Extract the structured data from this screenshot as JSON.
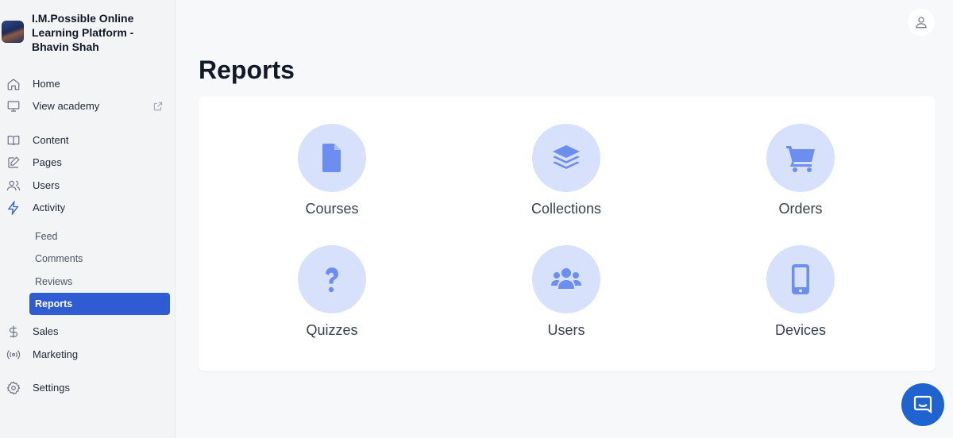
{
  "sidebar": {
    "brand": "I.M.Possible Online Learning Platform - Bhavin Shah",
    "items": [
      {
        "label": "Home",
        "icon": "home-icon"
      },
      {
        "label": "View academy",
        "icon": "monitor-icon"
      },
      {
        "label": "Content",
        "icon": "book-icon"
      },
      {
        "label": "Pages",
        "icon": "edit-icon"
      },
      {
        "label": "Users",
        "icon": "users-icon"
      },
      {
        "label": "Activity",
        "icon": "activity-icon"
      },
      {
        "label": "Sales",
        "icon": "dollar-icon"
      },
      {
        "label": "Marketing",
        "icon": "broadcast-icon"
      },
      {
        "label": "Settings",
        "icon": "gear-icon"
      }
    ],
    "activity_sub": [
      {
        "label": "Feed"
      },
      {
        "label": "Comments"
      },
      {
        "label": "Reviews"
      },
      {
        "label": "Reports",
        "active": true
      }
    ]
  },
  "main": {
    "title": "Reports",
    "tiles": [
      {
        "label": "Courses",
        "icon": "file-icon"
      },
      {
        "label": "Collections",
        "icon": "layers-icon"
      },
      {
        "label": "Orders",
        "icon": "cart-icon"
      },
      {
        "label": "Quizzes",
        "icon": "question-icon"
      },
      {
        "label": "Users",
        "icon": "user-group-icon"
      },
      {
        "label": "Devices",
        "icon": "mobile-icon"
      }
    ]
  },
  "colors": {
    "accent": "#2f5bd3",
    "tile_circle": "#d7e1fb",
    "tile_icon": "#6b8ef0",
    "chat_button": "#1f63d0"
  }
}
